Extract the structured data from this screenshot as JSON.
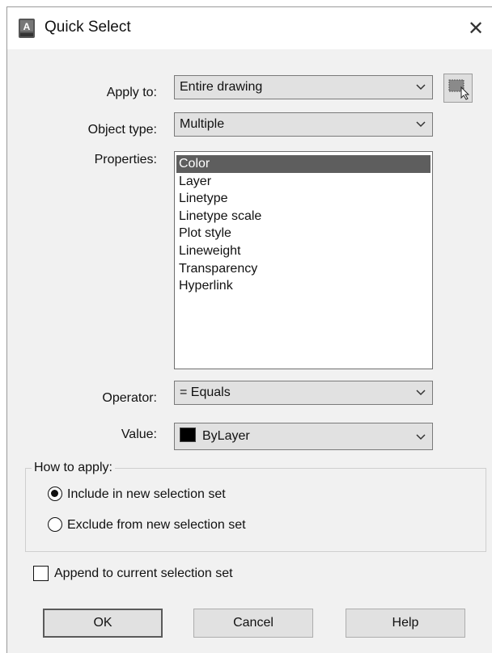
{
  "window": {
    "title": "Quick Select",
    "close_glyph": "✕",
    "app_icon": "autocad-app-icon"
  },
  "fields": {
    "apply_to": {
      "label": "Apply to:",
      "value": "Entire drawing"
    },
    "object_type": {
      "label": "Object type:",
      "value": "Multiple"
    },
    "properties": {
      "label": "Properties:",
      "items": [
        "Color",
        "Layer",
        "Linetype",
        "Linetype scale",
        "Plot style",
        "Lineweight",
        "Transparency",
        "Hyperlink"
      ],
      "selected": "Color"
    },
    "operator": {
      "label": "Operator:",
      "value": "= Equals"
    },
    "value": {
      "label": "Value:",
      "value": "ByLayer",
      "swatch_color": "#000000"
    }
  },
  "how_to_apply": {
    "legend": "How to apply:",
    "options": [
      "Include in new selection set",
      "Exclude from new selection set"
    ],
    "selected": "Include in new selection set"
  },
  "append": {
    "label": "Append to current selection set",
    "checked": false
  },
  "buttons": {
    "ok": "OK",
    "cancel": "Cancel",
    "help": "Help"
  },
  "colors": {
    "selection_bg": "#5e5e5e",
    "dialog_bg": "#f1f1f1"
  }
}
